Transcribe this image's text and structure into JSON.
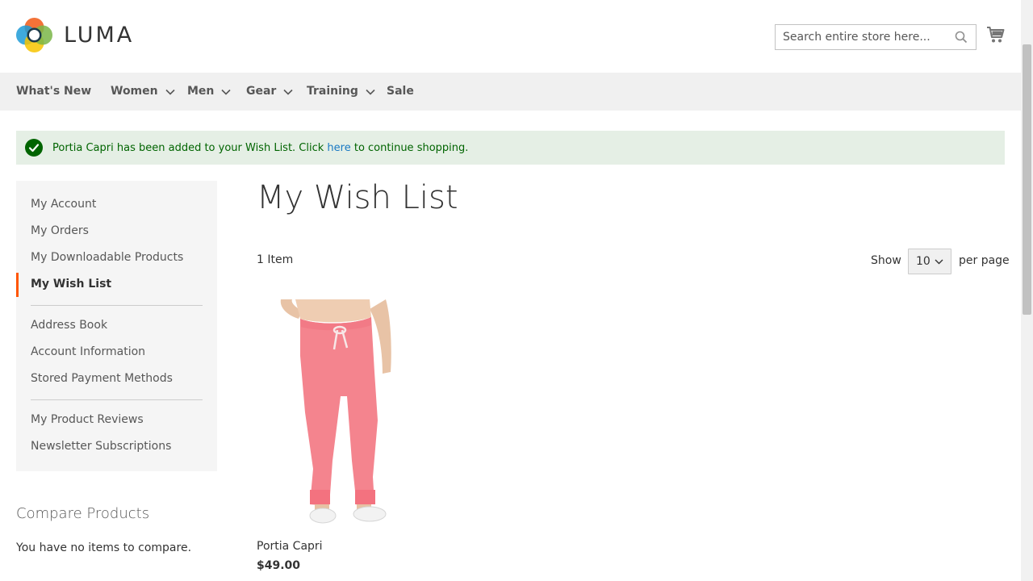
{
  "header": {
    "logo_text": "LUMA",
    "search_placeholder": "Search entire store here...",
    "search_icon": "magnifier-icon",
    "cart_icon": "shopping-cart-icon"
  },
  "nav": {
    "items": [
      {
        "label": "What's New",
        "has_dropdown": false
      },
      {
        "label": "Women",
        "has_dropdown": true
      },
      {
        "label": "Men",
        "has_dropdown": true
      },
      {
        "label": "Gear",
        "has_dropdown": true
      },
      {
        "label": "Training",
        "has_dropdown": true
      },
      {
        "label": "Sale",
        "has_dropdown": false
      }
    ]
  },
  "message": {
    "text_before": "Portia Capri has been added to your Wish List. Click ",
    "link": "here",
    "text_after": " to continue shopping.",
    "icon": "check-circle-icon",
    "bg_color": "#e5efe5",
    "text_color": "#006400"
  },
  "sidebar": {
    "items": [
      {
        "label": "My Account"
      },
      {
        "label": "My Orders"
      },
      {
        "label": "My Downloadable Products"
      },
      {
        "label": "My Wish List",
        "active": true
      },
      {
        "label": "Address Book"
      },
      {
        "label": "Account Information"
      },
      {
        "label": "Stored Payment Methods"
      },
      {
        "label": "My Product Reviews"
      },
      {
        "label": "Newsletter Subscriptions"
      }
    ],
    "active_color": "#ff5501"
  },
  "compare": {
    "title": "Compare Products",
    "empty_text": "You have no items to compare."
  },
  "main": {
    "title": "My Wish List",
    "item_count": "1 Item",
    "show_label": "Show",
    "limiter_value": "10",
    "per_page_label": "per page"
  },
  "product": {
    "name": "Portia Capri",
    "price": "$49.00"
  },
  "colors": {
    "link": "#1979c3",
    "nav_bg": "#f0f0f0",
    "sidebar_bg": "#f5f5f5"
  }
}
